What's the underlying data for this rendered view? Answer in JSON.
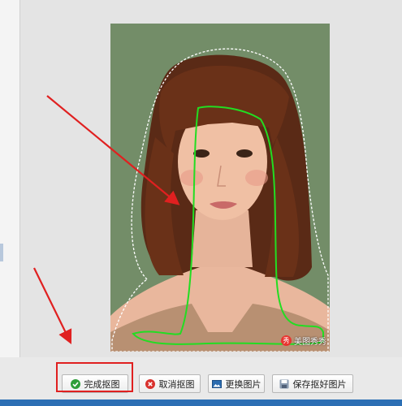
{
  "toolbar": {
    "complete_label": "完成抠图",
    "cancel_label": "取消抠图",
    "replace_label": "更换图片",
    "save_label": "保存抠好图片"
  },
  "watermark": {
    "logo_text": "秀",
    "text": "美图秀秀"
  },
  "colors": {
    "selection_outline": "#22dd22",
    "annotation_arrow": "#e02020",
    "photo_background": "#6f8a66"
  },
  "icons": {
    "complete": "check-circle-icon",
    "cancel": "x-circle-icon",
    "replace": "image-icon",
    "save": "floppy-icon"
  }
}
